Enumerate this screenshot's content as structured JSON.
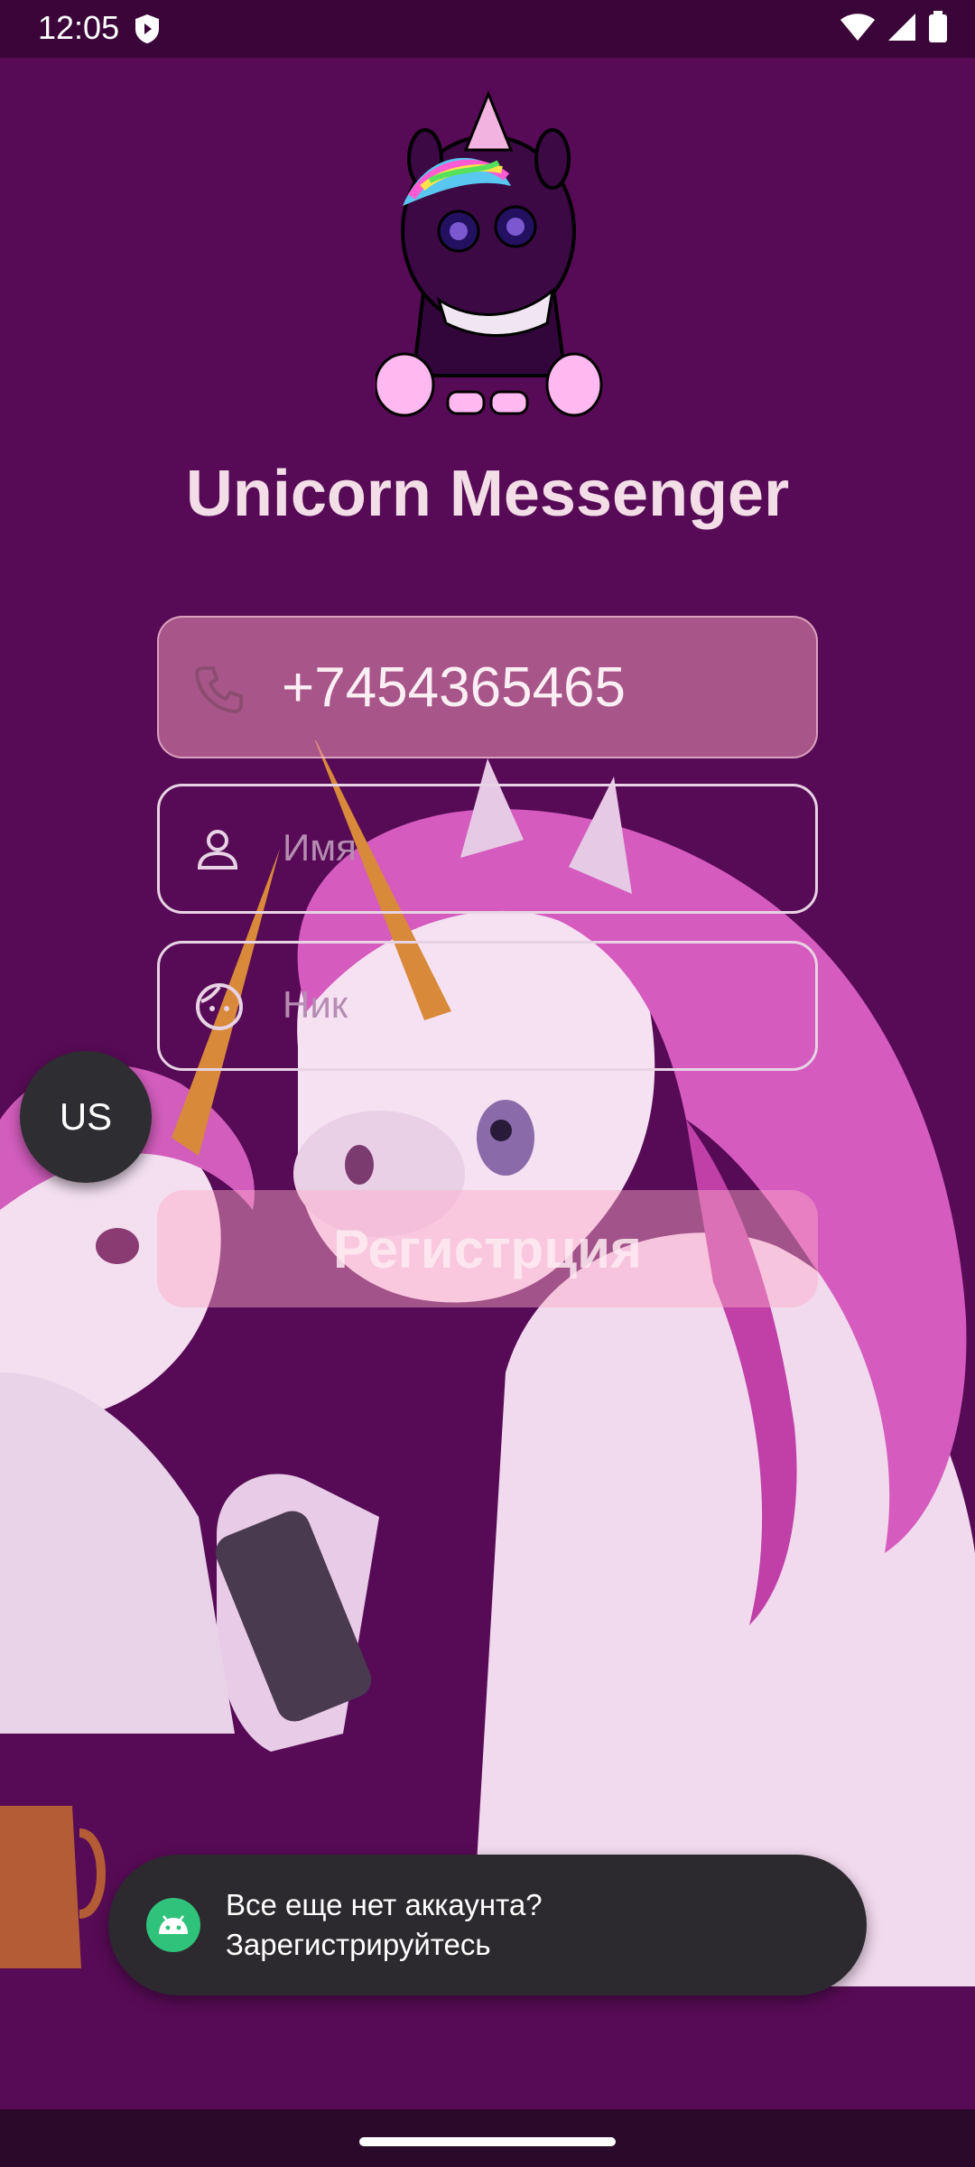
{
  "status_bar": {
    "time": "12:05"
  },
  "app": {
    "title": "Unicorn Messenger"
  },
  "form": {
    "phone_value": "+7454365465",
    "name_placeholder": "Имя",
    "nick_placeholder": "Ник"
  },
  "language_fab": {
    "label": "US"
  },
  "register_button": {
    "label": "Регистрция"
  },
  "toast": {
    "line1": "Все еще нет аккаунта?",
    "line2": "Зарегистрируйтесь"
  },
  "colors": {
    "background": "#570b56",
    "status_bar": "#3a0538",
    "title": "#f3dde7",
    "phone_field": "#c97aa2",
    "toast": "#2c2a2f"
  },
  "icons": {
    "phone": "phone-icon",
    "name": "person-icon",
    "nick": "face-icon",
    "toast": "android-icon"
  }
}
